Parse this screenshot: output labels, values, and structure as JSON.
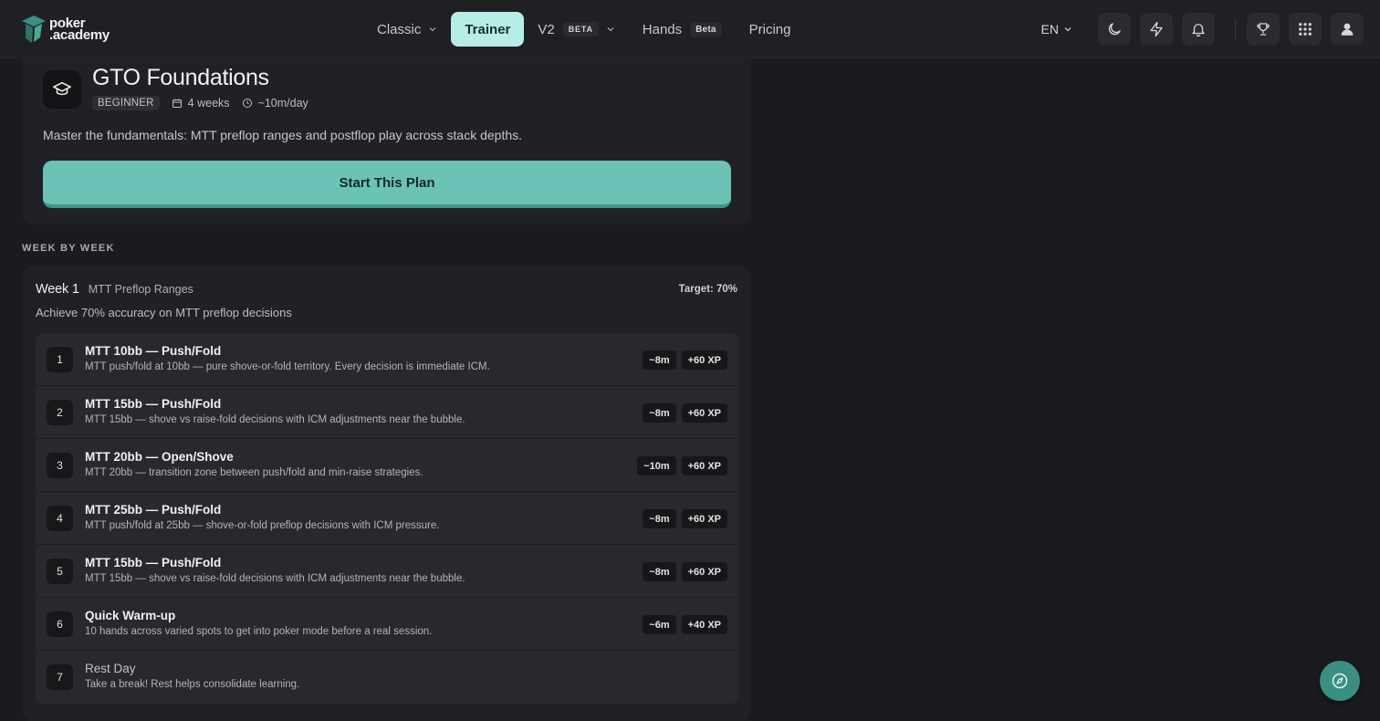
{
  "app": {
    "logo_line1": "poker",
    "logo_line2": ".academy"
  },
  "nav": {
    "items": [
      {
        "label": "Classic"
      },
      {
        "label": "Trainer"
      },
      {
        "label": "V2",
        "badge": "BETA"
      },
      {
        "label": "Hands",
        "badge": "Beta"
      },
      {
        "label": "Pricing"
      }
    ]
  },
  "toolbar": {
    "language": "EN",
    "icons": [
      "moon-icon",
      "bolt-icon",
      "bell-icon",
      "trophy-icon",
      "grid-icon",
      "user-icon"
    ]
  },
  "plan": {
    "title": "GTO Foundations",
    "level": "BEGINNER",
    "duration": "4 weeks",
    "daily_time": "~10m/day",
    "description": "Master the fundamentals: MTT preflop ranges and postflop play across stack depths.",
    "start_label": "Start This Plan"
  },
  "section_label": "WEEK BY WEEK",
  "week": {
    "number": "Week 1",
    "name": "MTT Preflop Ranges",
    "target": "Target: 70%",
    "description": "Achieve 70% accuracy on MTT preflop decisions",
    "lessons": [
      {
        "num": "1",
        "title": "MTT 10bb — Push/Fold",
        "subtitle": "MTT push/fold at 10bb — pure shove-or-fold territory. Every decision is immediate ICM.",
        "time": "~8m",
        "xp": "+60 XP"
      },
      {
        "num": "2",
        "title": "MTT 15bb — Push/Fold",
        "subtitle": "MTT 15bb — shove vs raise-fold decisions with ICM adjustments near the bubble.",
        "time": "~8m",
        "xp": "+60 XP"
      },
      {
        "num": "3",
        "title": "MTT 20bb — Open/Shove",
        "subtitle": "MTT 20bb — transition zone between push/fold and min-raise strategies.",
        "time": "~10m",
        "xp": "+60 XP"
      },
      {
        "num": "4",
        "title": "MTT 25bb — Push/Fold",
        "subtitle": "MTT push/fold at 25bb — shove-or-fold preflop decisions with ICM pressure.",
        "time": "~8m",
        "xp": "+60 XP"
      },
      {
        "num": "5",
        "title": "MTT 15bb — Push/Fold",
        "subtitle": "MTT 15bb — shove vs raise-fold decisions with ICM adjustments near the bubble.",
        "time": "~8m",
        "xp": "+60 XP"
      },
      {
        "num": "6",
        "title": "Quick Warm-up",
        "subtitle": "10 hands across varied spots to get into poker mode before a real session.",
        "time": "~6m",
        "xp": "+40 XP"
      },
      {
        "num": "7",
        "title": "Rest Day",
        "subtitle": "Take a break! Rest helps consolidate learning.",
        "time": "",
        "xp": ""
      }
    ]
  },
  "colors": {
    "accent": "#6cc3b5",
    "active_nav": "#b7ede6",
    "background": "#1a1b1e",
    "card": "#202124"
  }
}
